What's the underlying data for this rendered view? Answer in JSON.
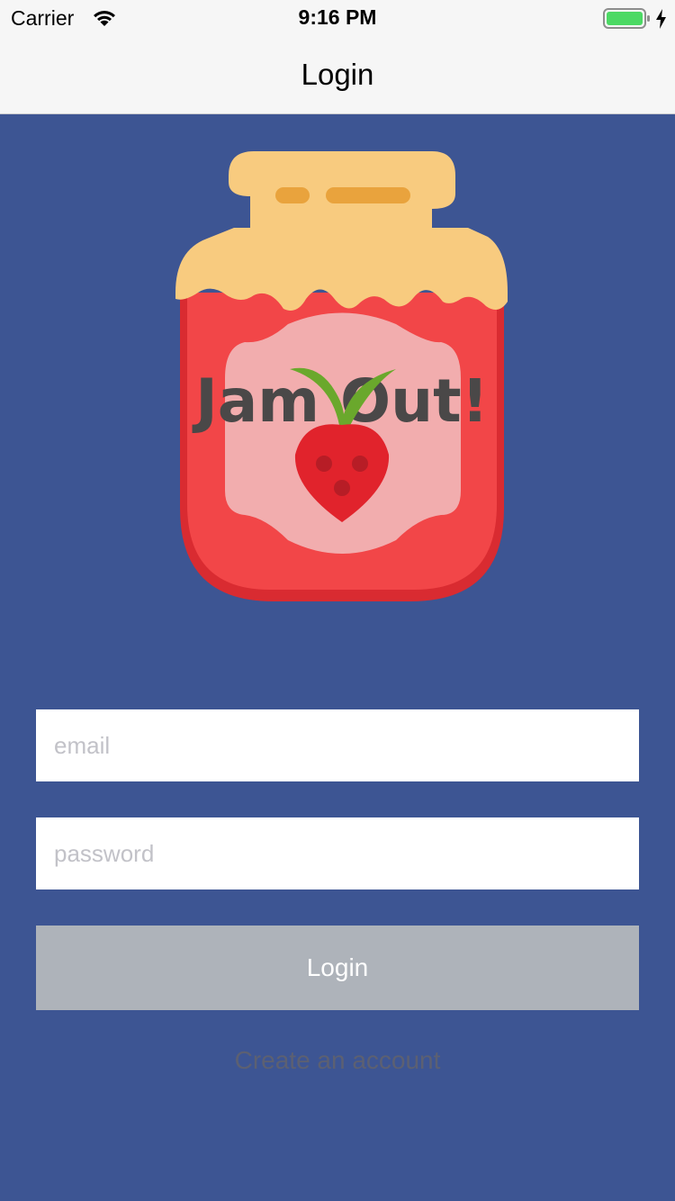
{
  "status_bar": {
    "carrier": "Carrier",
    "time": "9:16 PM",
    "icons": [
      "wifi-icon",
      "battery-icon",
      "charging-bolt-icon"
    ]
  },
  "nav": {
    "title": "Login"
  },
  "logo": {
    "text": "Jam Out!",
    "icon": "jam-jar-logo"
  },
  "form": {
    "email": {
      "value": "",
      "placeholder": "email"
    },
    "password": {
      "value": "",
      "placeholder": "password"
    },
    "login_label": "Login",
    "create_account_label": "Create an account"
  },
  "colors": {
    "background": "#3d5593",
    "button_disabled": "#aeb3ba",
    "jar_red": "#f24648",
    "lid": "#f8cb7f"
  }
}
